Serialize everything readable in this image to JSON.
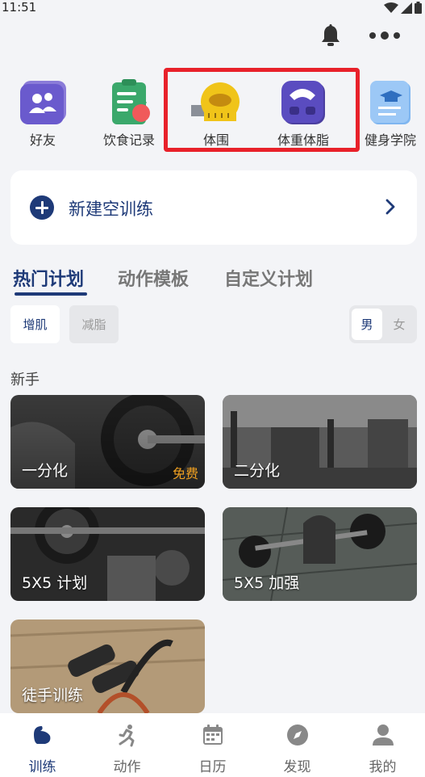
{
  "status_bar": {
    "time": "11:51"
  },
  "quick_actions": [
    {
      "label": "好友",
      "icon": "friends-icon"
    },
    {
      "label": "饮食记录",
      "icon": "diet-record-icon"
    },
    {
      "label": "体围",
      "icon": "tape-measure-icon"
    },
    {
      "label": "体重体脂",
      "icon": "scale-icon"
    },
    {
      "label": "健身学院",
      "icon": "academy-icon"
    }
  ],
  "new_training": {
    "label": "新建空训练"
  },
  "tabs": [
    {
      "label": "热门计划",
      "active": true
    },
    {
      "label": "动作模板",
      "active": false
    },
    {
      "label": "自定义计划",
      "active": false
    }
  ],
  "filters": {
    "gain": "增肌",
    "lose": "减脂"
  },
  "gender": {
    "male": "男",
    "female": "女"
  },
  "section_title": "新手",
  "plans": [
    {
      "name": "一分化",
      "badge": "免费"
    },
    {
      "name": "二分化"
    },
    {
      "name": "5X5 计划"
    },
    {
      "name": "5X5 加强"
    },
    {
      "name": "徒手训练"
    }
  ],
  "bottom_nav": [
    {
      "label": "训练",
      "icon": "training-icon",
      "active": true
    },
    {
      "label": "动作",
      "icon": "running-icon"
    },
    {
      "label": "日历",
      "icon": "calendar-icon"
    },
    {
      "label": "发现",
      "icon": "compass-icon"
    },
    {
      "label": "我的",
      "icon": "user-icon"
    }
  ],
  "colors": {
    "accent": "#1e3a78",
    "highlight": "#e8212a",
    "free_badge": "#f0a020"
  }
}
